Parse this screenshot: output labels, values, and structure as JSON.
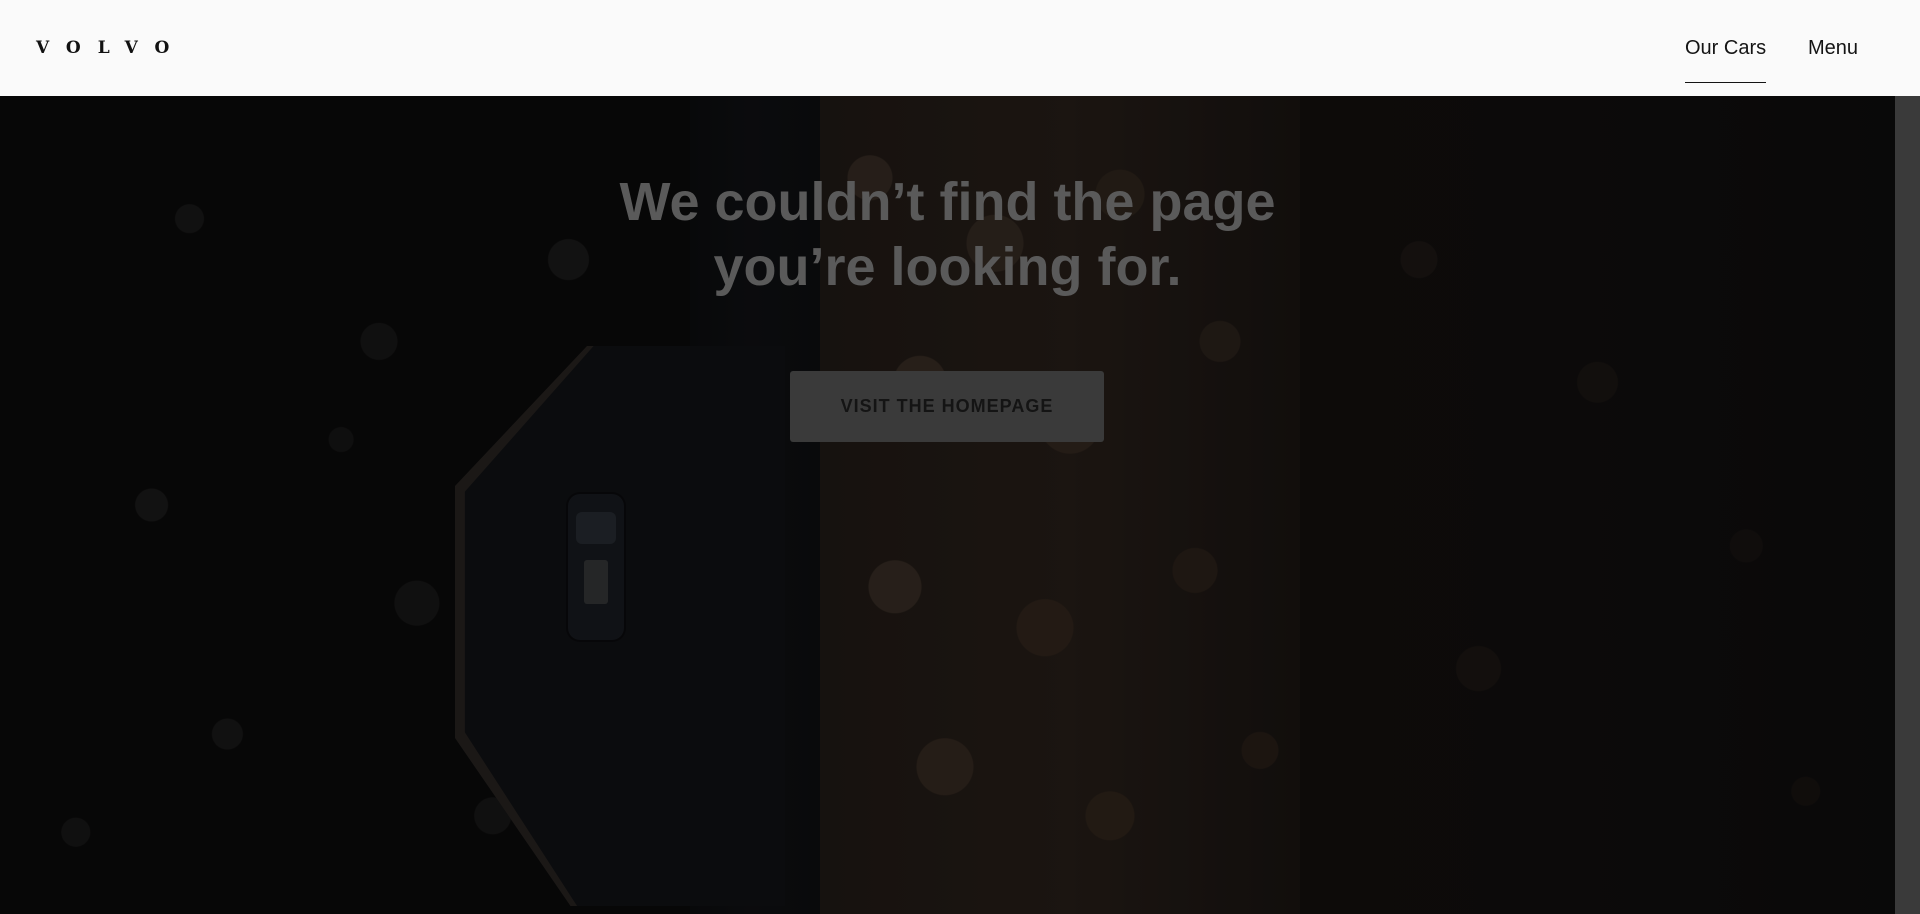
{
  "header": {
    "logo_text": "VOLVO",
    "nav": {
      "our_cars": "Our Cars",
      "menu": "Menu"
    }
  },
  "hero": {
    "headline_line1": "We couldn’t find the page",
    "headline_line2": "you’re looking for.",
    "cta_label": "VISIT THE HOMEPAGE"
  },
  "colors": {
    "header_bg": "#fafafa",
    "text_dark": "#141414",
    "headline": "#5a5a5a",
    "cta_bg": "#3a3a3a"
  }
}
